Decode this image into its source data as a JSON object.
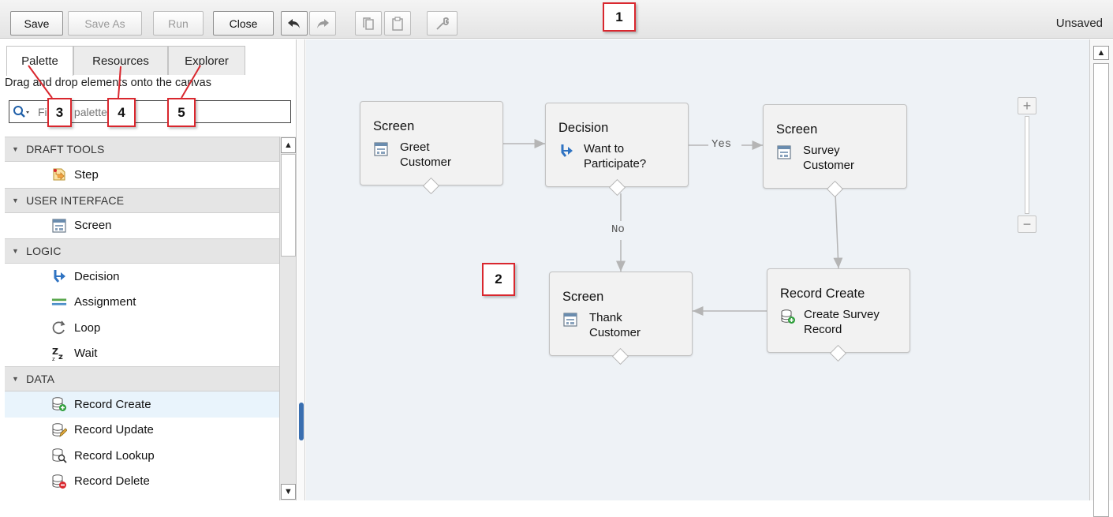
{
  "toolbar": {
    "save_label": "Save",
    "save_as_label": "Save As",
    "run_label": "Run",
    "close_label": "Close",
    "status": "Unsaved",
    "icons": [
      "undo-icon",
      "redo-icon",
      "copy-icon",
      "paste-icon",
      "wrench-icon"
    ]
  },
  "callouts": {
    "c1": "1",
    "c2": "2",
    "c3": "3",
    "c4": "4",
    "c5": "5"
  },
  "left_panel": {
    "tabs": [
      {
        "label": "Palette",
        "active": true
      },
      {
        "label": "Resources",
        "active": false
      },
      {
        "label": "Explorer",
        "active": false
      }
    ],
    "instructions": "Drag and drop elements onto the canvas",
    "search_placeholder": "Find in palette...",
    "sections": [
      {
        "title": "DRAFT TOOLS",
        "items": [
          {
            "label": "Step",
            "icon": "step-icon"
          }
        ]
      },
      {
        "title": "USER INTERFACE",
        "items": [
          {
            "label": "Screen",
            "icon": "screen-icon"
          }
        ]
      },
      {
        "title": "LOGIC",
        "items": [
          {
            "label": "Decision",
            "icon": "decision-icon"
          },
          {
            "label": "Assignment",
            "icon": "assignment-icon"
          },
          {
            "label": "Loop",
            "icon": "loop-icon"
          },
          {
            "label": "Wait",
            "icon": "wait-icon"
          }
        ]
      },
      {
        "title": "DATA",
        "items": [
          {
            "label": "Record Create",
            "icon": "record-create-icon",
            "selected": true
          },
          {
            "label": "Record Update",
            "icon": "record-update-icon"
          },
          {
            "label": "Record Lookup",
            "icon": "record-lookup-icon"
          },
          {
            "label": "Record Delete",
            "icon": "record-delete-icon"
          }
        ]
      }
    ]
  },
  "canvas": {
    "nodes": [
      {
        "id": "n1",
        "type": "Screen",
        "label": "Greet\nCustomer",
        "icon": "screen-icon"
      },
      {
        "id": "n2",
        "type": "Decision",
        "label": "Want to\nParticipate?",
        "icon": "decision-icon"
      },
      {
        "id": "n3",
        "type": "Screen",
        "label": "Survey\nCustomer",
        "icon": "screen-icon"
      },
      {
        "id": "n4",
        "type": "Screen",
        "label": "Thank\nCustomer",
        "icon": "screen-icon"
      },
      {
        "id": "n5",
        "type": "Record Create",
        "label": "Create Survey\nRecord",
        "icon": "record-create-icon"
      }
    ],
    "connector_labels": {
      "yes": "Yes",
      "no": "No"
    },
    "zoom": {
      "plus": "+",
      "minus": "−"
    }
  }
}
